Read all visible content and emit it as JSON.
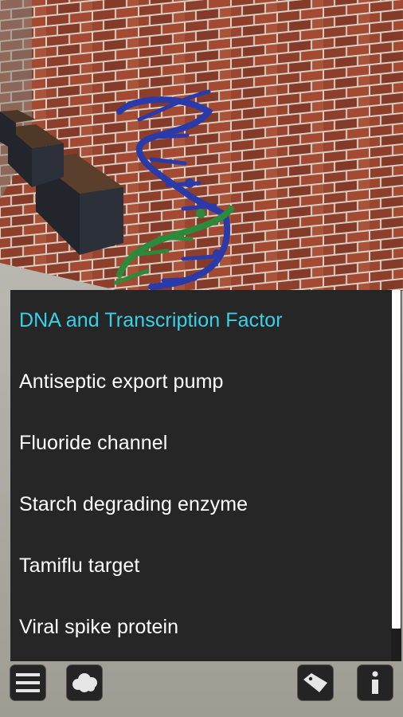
{
  "menu": {
    "items": [
      {
        "label": "DNA and Transcription Factor",
        "selected": true
      },
      {
        "label": "Antiseptic export pump",
        "selected": false
      },
      {
        "label": "Fluoride channel",
        "selected": false
      },
      {
        "label": "Starch degrading enzyme",
        "selected": false
      },
      {
        "label": "Tamiflu target",
        "selected": false
      },
      {
        "label": "Viral spike protein",
        "selected": false
      }
    ]
  },
  "toolbar": {
    "buttons": [
      {
        "name": "menu-button",
        "icon": "hamburger-menu-icon"
      },
      {
        "name": "cloud-button",
        "icon": "cloud-icon"
      },
      {
        "name": "label-button",
        "icon": "tag-icon"
      },
      {
        "name": "info-button",
        "icon": "info-icon"
      }
    ]
  },
  "colors": {
    "selected_text": "#37d2e8",
    "menu_background": "#262626",
    "dna_strand_blue": "#2a3aa8",
    "dna_strand_green": "#2c8a3a"
  }
}
